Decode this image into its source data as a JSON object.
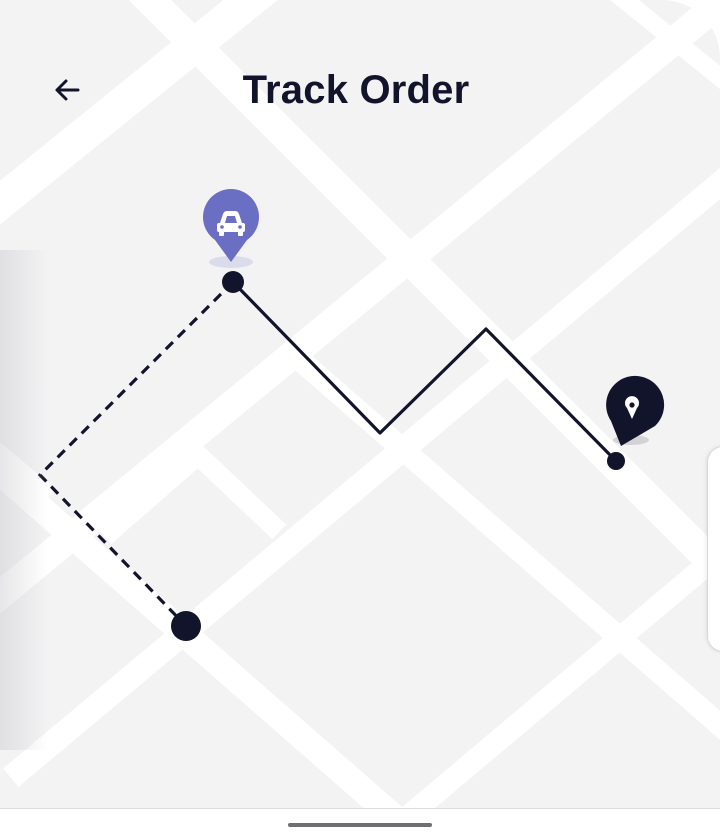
{
  "header": {
    "title": "Track Order",
    "back_icon": "arrow-left-icon"
  },
  "map": {
    "driver_marker_icon": "car-icon",
    "destination_marker_icon": "location-pin-icon",
    "colors": {
      "background": "#f3f3f4",
      "road": "#ffffff",
      "route": "#12142b",
      "driver_marker": "#6b6fc4"
    }
  }
}
